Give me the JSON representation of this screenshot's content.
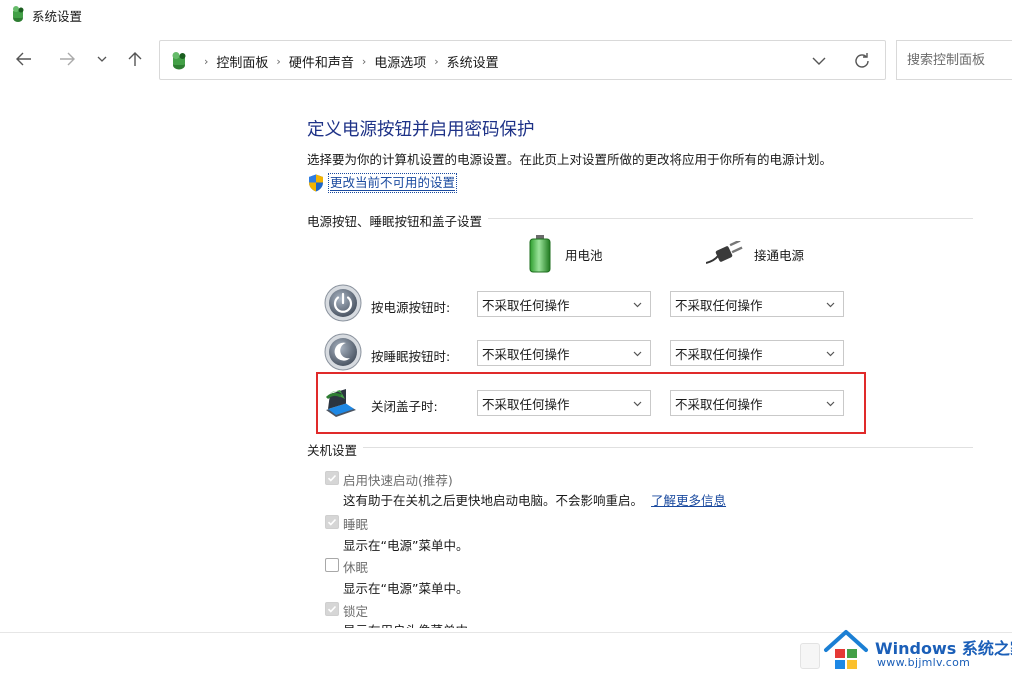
{
  "window": {
    "title": "系统设置"
  },
  "nav": {
    "back_icon": "arrow-left-icon",
    "forward_icon": "arrow-right-icon",
    "recent_icon": "chevron-down-icon",
    "up_icon": "arrow-up-icon"
  },
  "breadcrumb": {
    "items": [
      "控制面板",
      "硬件和声音",
      "电源选项",
      "系统设置"
    ],
    "separator": "›"
  },
  "search": {
    "placeholder": "搜索控制面板"
  },
  "page": {
    "heading": "定义电源按钮并启用密码保护",
    "description": "选择要为你的计算机设置的电源设置。在此页上对设置所做的更改将应用于你所有的电源计划。",
    "change_link": "更改当前不可用的设置"
  },
  "power_buttons": {
    "section_title": "电源按钮、睡眠按钮和盖子设置",
    "col_battery": "用电池",
    "col_plugged": "接通电源",
    "rows": [
      {
        "label": "按电源按钮时:",
        "battery": "不采取任何操作",
        "plugged": "不采取任何操作",
        "icon": "power-button-icon"
      },
      {
        "label": "按睡眠按钮时:",
        "battery": "不采取任何操作",
        "plugged": "不采取任何操作",
        "icon": "sleep-button-icon"
      },
      {
        "label": "关闭盖子时:",
        "battery": "不采取任何操作",
        "plugged": "不采取任何操作",
        "icon": "laptop-lid-icon"
      }
    ]
  },
  "shutdown": {
    "section_title": "关机设置",
    "items": [
      {
        "label": "启用快速启动(推荐)",
        "checked": true,
        "disabled": true,
        "description": "这有助于在关机之后更快地启动电脑。不会影响重启。",
        "link": "了解更多信息"
      },
      {
        "label": "睡眠",
        "checked": true,
        "disabled": true,
        "description": "显示在“电源”菜单中。"
      },
      {
        "label": "休眠",
        "checked": false,
        "disabled": true,
        "description": "显示在“电源”菜单中。"
      },
      {
        "label": "锁定",
        "checked": true,
        "disabled": true,
        "description": "显示在用户头像菜单中。"
      }
    ]
  },
  "watermark": {
    "title_en": "Windows",
    "title_cn": "系统之家",
    "url": "www.bjjmlv.com"
  },
  "colors": {
    "heading": "#1e3287",
    "link": "#1a4a9f",
    "highlight": "#e02a2a",
    "watermark": "#1b5fb8"
  }
}
